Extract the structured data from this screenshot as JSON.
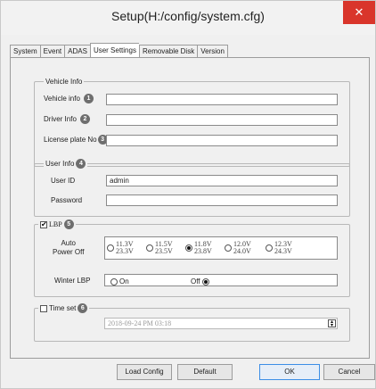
{
  "window": {
    "title": "Setup(H:/config/system.cfg)",
    "close_icon": "close-x-icon",
    "close_glyph": "✕",
    "close_color": "#d9352b"
  },
  "tabs": [
    "System",
    "Event",
    "ADAS",
    "User Settings",
    "Removable Disk",
    "Version"
  ],
  "active_tab": "User Settings",
  "vehicle_info": {
    "legend": "Vehicle Info",
    "rows": [
      {
        "label": "Vehicle info",
        "badge": "1",
        "value": ""
      },
      {
        "label": "Driver Info",
        "badge": "2",
        "value": ""
      },
      {
        "label": "License plate No",
        "badge": "3",
        "value": ""
      }
    ]
  },
  "user_info": {
    "legend": "User Info",
    "badge": "4",
    "user_id_label": "User ID",
    "user_id_value": "admin",
    "password_label": "Password",
    "password_value": ""
  },
  "lbp": {
    "legend": "LBP",
    "badge": "5",
    "checked": true,
    "auto_power_off_label_1": "Auto",
    "auto_power_off_label_2": "Power Off",
    "options": [
      {
        "top": "11.3V",
        "bottom": "23.3V",
        "selected": false
      },
      {
        "top": "11.5V",
        "bottom": "23.5V",
        "selected": false
      },
      {
        "top": "11.8V",
        "bottom": "23.8V",
        "selected": true
      },
      {
        "top": "12.0V",
        "bottom": "24.0V",
        "selected": false
      },
      {
        "top": "12.3V",
        "bottom": "24.3V",
        "selected": false
      }
    ],
    "winter_label": "Winter LBP",
    "winter_on_label": "On",
    "winter_off_label": "Off",
    "winter_selected": "Off"
  },
  "time_set": {
    "legend": "Time set",
    "badge": "6",
    "checked": false,
    "value": "2018-09-24   PM 03:18",
    "spin_icon": "spin-updown-icon"
  },
  "buttons": {
    "load_config": "Load Config",
    "default": "Default",
    "ok": "OK",
    "cancel": "Cancel"
  }
}
